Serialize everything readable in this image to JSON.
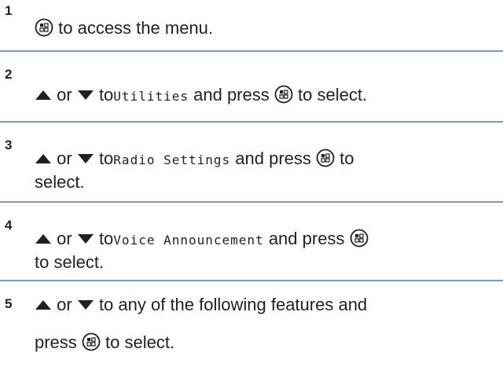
{
  "steps": [
    {
      "number": "1",
      "text_1": "to access the menu."
    },
    {
      "number": "2",
      "or": "or",
      "to": "to",
      "menu_item": "Utilities",
      "text_2": "and press",
      "text_3": "to select."
    },
    {
      "number": "3",
      "or": "or",
      "to": "to",
      "menu_item": "Radio Settings",
      "text_2": "and press",
      "text_3": "to",
      "text_4": "select."
    },
    {
      "number": "4",
      "or": "or",
      "to": "to",
      "menu_item": "Voice Announcement",
      "text_2": "and press",
      "text_3": "to select."
    },
    {
      "number": "5",
      "or": "or",
      "text_1": "to any of the following features and",
      "text_2": "press",
      "text_3": "to select."
    }
  ],
  "icons": {
    "menu_ok": "menu-ok-button-icon",
    "up": "up-arrow-icon",
    "down": "down-arrow-icon"
  },
  "colors": {
    "divider": "#7d9bb8",
    "text": "#231f20"
  }
}
